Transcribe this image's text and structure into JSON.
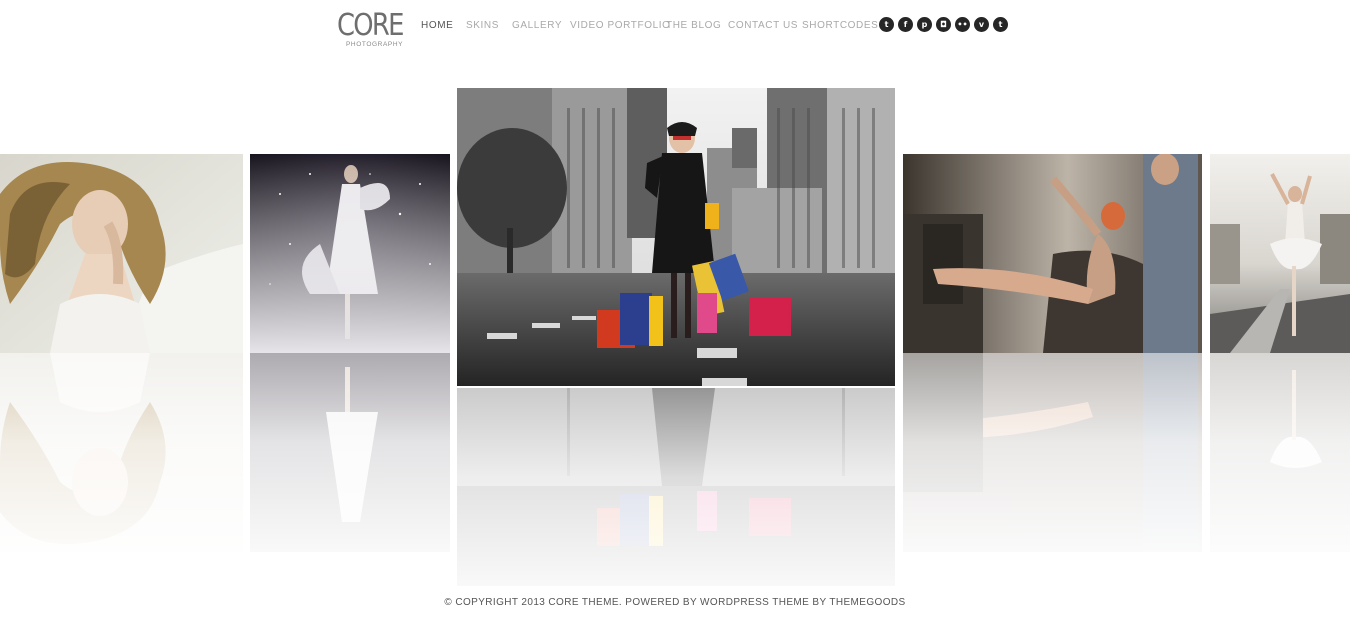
{
  "logo": {
    "main": "CORE",
    "sub": "PHOTOGRAPHY"
  },
  "nav": {
    "items": [
      {
        "label": "HOME",
        "active": true
      },
      {
        "label": "SKINS",
        "active": false
      },
      {
        "label": "GALLERY",
        "active": false
      },
      {
        "label": "VIDEO PORTFOLIO",
        "active": false
      },
      {
        "label": "THE BLOG",
        "active": false
      },
      {
        "label": "CONTACT US",
        "active": false
      },
      {
        "label": "SHORTCODES",
        "active": false
      }
    ]
  },
  "social": {
    "icons": [
      {
        "name": "twitter-icon",
        "glyph": "t"
      },
      {
        "name": "facebook-icon",
        "glyph": "f"
      },
      {
        "name": "pinterest-icon",
        "glyph": "p"
      },
      {
        "name": "instagram-icon",
        "glyph": "◘"
      },
      {
        "name": "flickr-icon",
        "glyph": "••"
      },
      {
        "name": "vimeo-icon",
        "glyph": "v"
      },
      {
        "name": "tumblr-icon",
        "glyph": "t"
      }
    ]
  },
  "gallery": {
    "photos": [
      {
        "name": "photo-woman-curly-hair",
        "subject": "woman with curly hair lying on white sheets"
      },
      {
        "name": "photo-woman-white-gown",
        "subject": "woman in white gown in the dark with smoke"
      },
      {
        "name": "photo-woman-shopping",
        "subject": "woman with shopping bags on a city street",
        "featured": true
      },
      {
        "name": "photo-salon-woman",
        "subject": "woman relaxing in salon chair with hairdresser"
      },
      {
        "name": "photo-ballerina",
        "subject": "ballerina dancing on a road"
      }
    ]
  },
  "footer": {
    "text": "© COPYRIGHT 2013 CORE THEME. POWERED BY WORDPRESS THEME BY THEMEGOODS"
  }
}
